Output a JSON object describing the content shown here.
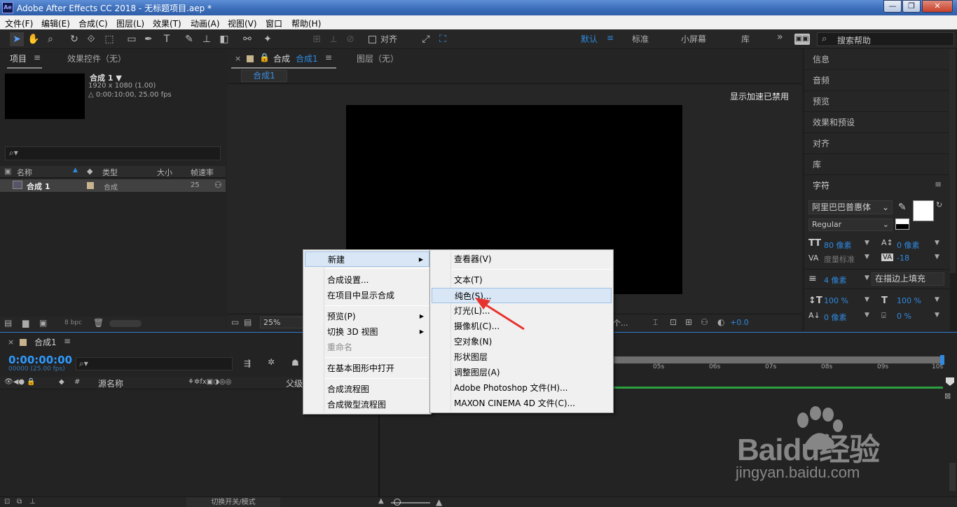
{
  "titlebar": {
    "title": "Adobe After Effects CC 2018 - 无标题项目.aep *",
    "logo": "Ae",
    "min": "—",
    "max": "❐",
    "close": "✕"
  },
  "menu": [
    "文件(F)",
    "编辑(E)",
    "合成(C)",
    "图层(L)",
    "效果(T)",
    "动画(A)",
    "视图(V)",
    "窗口",
    "帮助(H)"
  ],
  "toolbar": {
    "align_label": "对齐",
    "workspaces": [
      "默认",
      "标准",
      "小屏幕",
      "库"
    ],
    "more": "»",
    "search_help": "搜索帮助"
  },
  "project": {
    "tab_project": "项目",
    "tab_effects": "效果控件（无）",
    "comp_name": "合成 1 ▼",
    "comp_res": "1920 x 1080 (1.00)",
    "comp_dur": "△ 0:00:10:00, 25.00 fps",
    "search_placeholder": "",
    "columns": [
      "名称",
      "类型",
      "大小",
      "帧速率"
    ],
    "row": {
      "name": "合成 1",
      "type": "合成",
      "fps": "25"
    },
    "bpc": "8 bpc"
  },
  "composition": {
    "tab_label": "合成",
    "tab_name": "合成1",
    "layer_tab": "图层（无）",
    "breadcrumb": "合成1",
    "accel_notice": "显示加速已禁用",
    "zoom": "25%",
    "view_count": "个...",
    "exposure": "+0.0"
  },
  "right_panels": [
    "信息",
    "音频",
    "预览",
    "效果和预设",
    "对齐",
    "库"
  ],
  "character": {
    "title": "字符",
    "font": "阿里巴巴普惠体",
    "style": "Regular",
    "size": "80 像素",
    "leading": "0 像素",
    "kerning": "度量标准",
    "tracking": "-18",
    "stroke": "4 像素",
    "stroke_mode": "在描边上填充",
    "vscale": "100 %",
    "hscale": "100 %",
    "baseline": "0 像素",
    "tsume": "0 %"
  },
  "timeline": {
    "tab": "合成1",
    "timecode": "0:00:00:00",
    "frames": "00000 (25.00 fps)",
    "col_source": "源名称",
    "col_parent": "父级",
    "ruler": [
      "05s",
      "06s",
      "07s",
      "08s",
      "09s",
      "10s"
    ],
    "footer": "切换开关/模式"
  },
  "context_menu": {
    "items": [
      {
        "label": "新建",
        "submenu": true,
        "highlight": true
      },
      {
        "label": "合成设置..."
      },
      {
        "label": "在项目中显示合成"
      },
      {
        "label": "预览(P)",
        "submenu": true
      },
      {
        "label": "切换 3D 视图",
        "submenu": true
      },
      {
        "label": "重命名",
        "disabled": true
      },
      {
        "label": "在基本图形中打开"
      },
      {
        "label": "合成流程图"
      },
      {
        "label": "合成微型流程图"
      }
    ]
  },
  "submenu": {
    "items": [
      "查看器(V)",
      "文本(T)",
      "纯色(S)...",
      "灯光(L)...",
      "摄像机(C)...",
      "空对象(N)",
      "形状图层",
      "调整图层(A)",
      "Adobe Photoshop 文件(H)...",
      "MAXON CINEMA 4D 文件(C)..."
    ]
  },
  "watermark": {
    "brand": "Baidu经验",
    "url": "jingyan.baidu.com"
  },
  "colors": {
    "accent": "#2f8ae0",
    "highlight_arrow": "#e8322e",
    "comp_swatch": "#c8b48c"
  }
}
